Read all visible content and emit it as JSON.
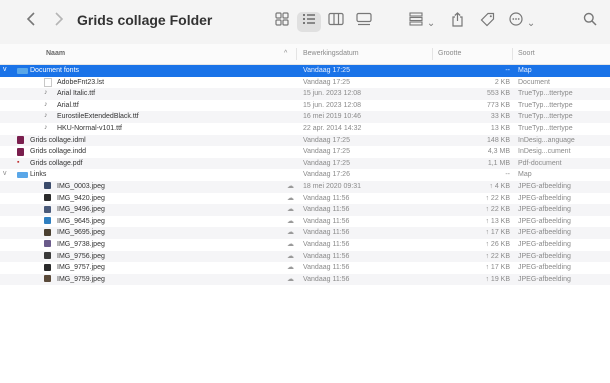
{
  "toolbar": {
    "back_icon": "chevron-left-icon",
    "forward_icon": "chevron-right-icon",
    "title": "Grids collage Folder",
    "search_icon": "search-icon"
  },
  "header": {
    "name": "Naam",
    "date": "Bewerkingsdatum",
    "size": "Grootte",
    "kind": "Soort",
    "sort_indicator": "^"
  },
  "rows": [
    {
      "name": "Document fonts",
      "date": "Vandaag 17:25",
      "size": "--",
      "kind": "Map",
      "icon": "folder-icon",
      "indent": 0,
      "disclosure": "v",
      "selected": true
    },
    {
      "name": "AdobeFnt23.lst",
      "date": "Vandaag 17:25",
      "size": "2 KB",
      "kind": "Document",
      "icon": "document-icon",
      "indent": 1
    },
    {
      "name": "Arial Italic.ttf",
      "date": "15 jun. 2023 12:08",
      "size": "553 KB",
      "kind": "TrueTyp...ttertype",
      "icon": "font-file-icon",
      "indent": 1
    },
    {
      "name": "Arial.ttf",
      "date": "15 jun. 2023 12:08",
      "size": "773 KB",
      "kind": "TrueTyp...ttertype",
      "icon": "font-file-icon",
      "indent": 1
    },
    {
      "name": "EurostileExtendedBlack.ttf",
      "date": "16 mei 2019 10:46",
      "size": "33 KB",
      "kind": "TrueTyp...ttertype",
      "icon": "font-file-icon",
      "indent": 1
    },
    {
      "name": "HKU-Normal-v101.ttf",
      "date": "22 apr. 2014 14:32",
      "size": "13 KB",
      "kind": "TrueTyp...ttertype",
      "icon": "font-file-icon",
      "indent": 1
    },
    {
      "name": "Grids collage.idml",
      "date": "Vandaag 17:25",
      "size": "148 KB",
      "kind": "InDesig...anguage",
      "icon": "indesign-icon",
      "indent": 0
    },
    {
      "name": "Grids collage.indd",
      "date": "Vandaag 17:25",
      "size": "4,3 MB",
      "kind": "InDesig...cument",
      "icon": "indesign-icon",
      "indent": 0
    },
    {
      "name": "Grids collage.pdf",
      "date": "Vandaag 17:25",
      "size": "1,1 MB",
      "kind": "Pdf-document",
      "icon": "pdf-icon",
      "indent": 0
    },
    {
      "name": "Links",
      "date": "Vandaag 17:26",
      "size": "--",
      "kind": "Map",
      "icon": "folder-icon",
      "indent": 0,
      "disclosure": "v"
    },
    {
      "name": "IMG_0003.jpeg",
      "date": "18 mei 2020 09:31",
      "size": "↑ 4 KB",
      "kind": "JPEG-afbeelding",
      "icon": "image-icon",
      "indent": 1,
      "cloud": true,
      "thumb": "#3a4a6a"
    },
    {
      "name": "IMG_9420.jpeg",
      "date": "Vandaag 11:56",
      "size": "↑ 22 KB",
      "kind": "JPEG-afbeelding",
      "icon": "image-icon",
      "indent": 1,
      "cloud": true,
      "thumb": "#2a2a2a"
    },
    {
      "name": "IMG_9496.jpeg",
      "date": "Vandaag 11:56",
      "size": "↑ 22 KB",
      "kind": "JPEG-afbeelding",
      "icon": "image-icon",
      "indent": 1,
      "cloud": true,
      "thumb": "#4a5a7a"
    },
    {
      "name": "IMG_9645.jpeg",
      "date": "Vandaag 11:56",
      "size": "↑ 13 KB",
      "kind": "JPEG-afbeelding",
      "icon": "image-icon",
      "indent": 1,
      "cloud": true,
      "thumb": "#2f7fc0"
    },
    {
      "name": "IMG_9695.jpeg",
      "date": "Vandaag 11:56",
      "size": "↑ 17 KB",
      "kind": "JPEG-afbeelding",
      "icon": "image-icon",
      "indent": 1,
      "cloud": true,
      "thumb": "#4a4030"
    },
    {
      "name": "IMG_9738.jpeg",
      "date": "Vandaag 11:56",
      "size": "↑ 26 KB",
      "kind": "JPEG-afbeelding",
      "icon": "image-icon",
      "indent": 1,
      "cloud": true,
      "thumb": "#6a5a8a"
    },
    {
      "name": "IMG_9756.jpeg",
      "date": "Vandaag 11:56",
      "size": "↑ 22 KB",
      "kind": "JPEG-afbeelding",
      "icon": "image-icon",
      "indent": 1,
      "cloud": true,
      "thumb": "#3a3a3a"
    },
    {
      "name": "IMG_9757.jpeg",
      "date": "Vandaag 11:56",
      "size": "↑ 17 KB",
      "kind": "JPEG-afbeelding",
      "icon": "image-icon",
      "indent": 1,
      "cloud": true,
      "thumb": "#2a2a2a"
    },
    {
      "name": "IMG_9759.jpeg",
      "date": "Vandaag 11:56",
      "size": "↑ 19 KB",
      "kind": "JPEG-afbeelding",
      "icon": "image-icon",
      "indent": 1,
      "cloud": true,
      "thumb": "#5a4a3a"
    }
  ],
  "colors": {
    "selection": "#1a73e8",
    "folder": "#5aa7e8",
    "indesign": "#7a1f4e",
    "pdf": "#c03030"
  }
}
